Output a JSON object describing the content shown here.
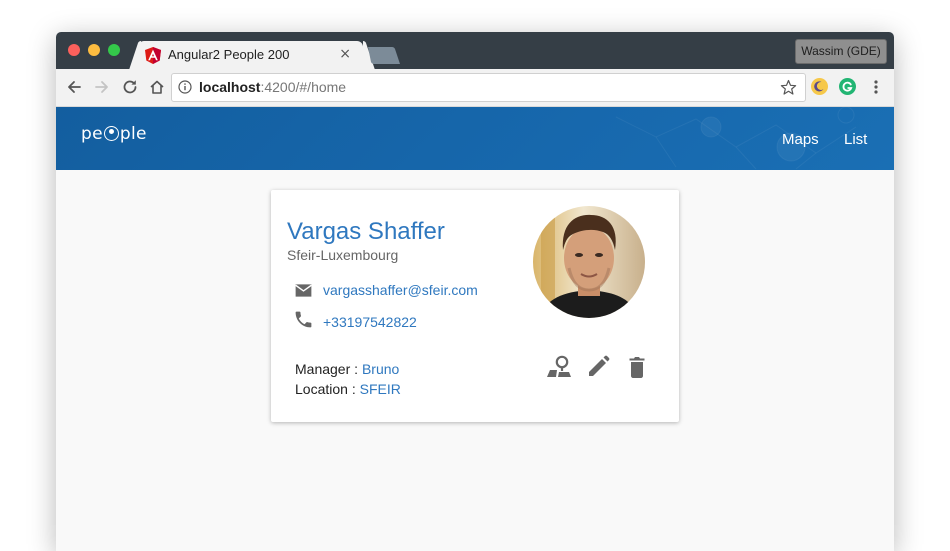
{
  "browser": {
    "tab": {
      "title": "Angular2 People 200",
      "close_glyph": "×",
      "favicon": "angular-icon"
    },
    "profile_label": "Wassim (GDE)",
    "address": {
      "host": "localhost",
      "path": ":4200/#/home"
    },
    "colors": {
      "titlebar": "#353e46",
      "tab": "#f2f2f2",
      "light_close": "#fc605c",
      "light_min": "#fdbc40",
      "light_max": "#34c84a"
    }
  },
  "app": {
    "brand": {
      "prefix": "pe",
      "suffix": "ple"
    },
    "nav": [
      {
        "label": "Maps"
      },
      {
        "label": "List"
      }
    ],
    "colors": {
      "appbar": "#1565a9",
      "link": "#2f78bf"
    }
  },
  "person": {
    "name": "Vargas Shaffer",
    "company": "Sfeir-Luxembourg",
    "email": "vargasshaffer@sfeir.com",
    "phone": "+33197542822",
    "manager_label": "Manager :",
    "manager": "Bruno",
    "location_label": "Location :",
    "location": "SFEIR",
    "icons": [
      "email-icon",
      "phone-icon",
      "map-pin-icon",
      "edit-icon",
      "delete-icon"
    ]
  }
}
